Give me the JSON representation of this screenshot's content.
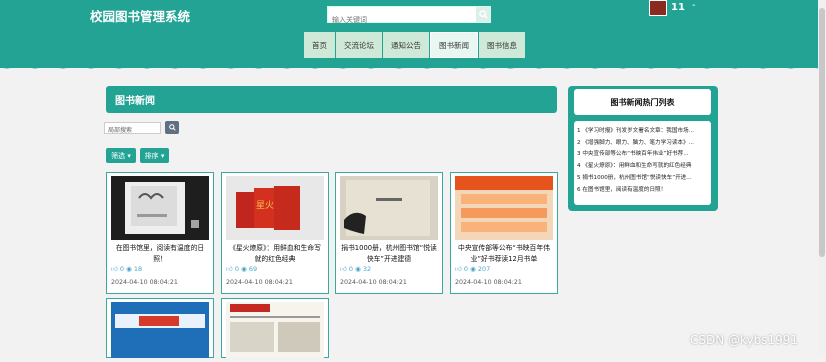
{
  "header": {
    "site_title": "校园图书管理系统",
    "search_placeholder": "输入关键词",
    "user_count": "11",
    "user_dash": "-"
  },
  "nav": [
    "首页",
    "交流论坛",
    "通知公告",
    "图书新闻",
    "图书信息"
  ],
  "nav_active_index": 3,
  "main": {
    "panel_title": "图书新闻",
    "local_search_placeholder": "局部搜索",
    "filter_label": "筛选",
    "sort_label": "排序"
  },
  "cards": [
    {
      "title": "在图书馆里，阅读有温度的日照！",
      "likes": "0",
      "views": "18",
      "date": "2024-04-10 08:04:21"
    },
    {
      "title": "《星火燎原》：用鲜血和生命写就的红色经典",
      "likes": "0",
      "views": "69",
      "date": "2024-04-10 08:04:21"
    },
    {
      "title": "捐书1000册，杭州图书馆“悦读快车”开进建德",
      "likes": "0",
      "views": "32",
      "date": "2024-04-10 08:04:21"
    },
    {
      "title": "中央宣传部等公布“书映百年伟业”好书荐读12月书单",
      "likes": "0",
      "views": "207",
      "date": "2024-04-10 08:04:21"
    }
  ],
  "hot": {
    "title": "图书新闻热门列表",
    "items": [
      "1 《学习时报》刊发岁文署名文章：我国市场...",
      "2 《增强脚力、眼力、脑力、笔力学习读本》...",
      "3 中央宣传部等公布“书映百年伟业”好书荐...",
      "4 《星火燎原》：用鲜血和生命写就的红色经典",
      "5 捐书1000册，杭州图书馆“悦读快车”开进...",
      "6 在图书馆里，阅读有温度的日照！"
    ]
  },
  "watermark": "CSDN @kybs1991",
  "colors": {
    "accent": "#23a394",
    "icon_blue": "#4aa5c8"
  }
}
